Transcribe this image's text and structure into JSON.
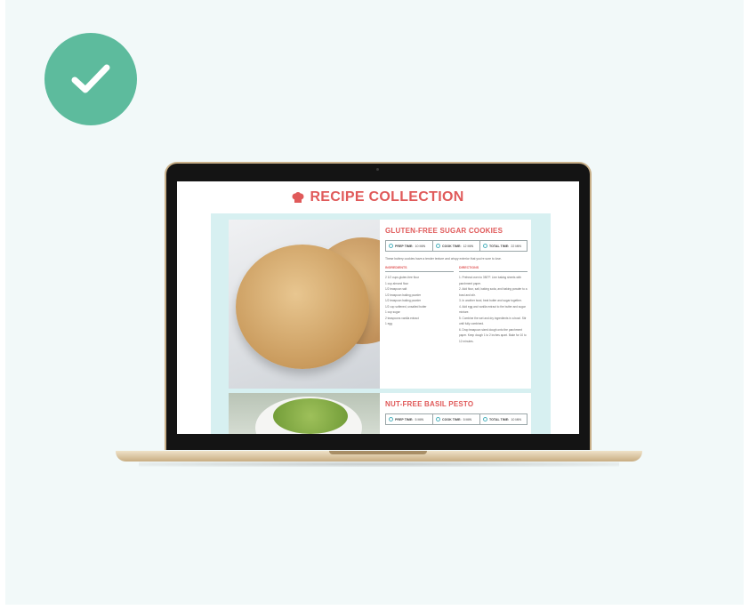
{
  "badge": {
    "icon": "checkmark-icon",
    "color": "#5dbb9d"
  },
  "page": {
    "title": "RECIPE COLLECTION",
    "icon": "chef-hat-icon",
    "accent": "#e05a5a",
    "collection_bg": "#d7f0f1"
  },
  "recipes": [
    {
      "title": "GLUTEN-FREE SUGAR COOKIES",
      "times": [
        {
          "label": "PREP TIME:",
          "value": "10 MIN"
        },
        {
          "label": "COOK TIME:",
          "value": "12 MIN"
        },
        {
          "label": "TOTAL TIME:",
          "value": "22 MIN"
        }
      ],
      "description": "These buttery cookies have a tender texture and crispy exterior that you're sure to love.",
      "ingredients_heading": "INGREDIENTS",
      "directions_heading": "DIRECTIONS",
      "ingredients": [
        "2 1/2 cups gluten-free flour",
        "1 cup almond flour",
        "1/2 teaspoon salt",
        "1/2 teaspoon baking powder",
        "1/2 teaspoon baking powder",
        "1/2 cup softened, unsalted butter",
        "1 cup sugar",
        "2 teaspoons vanilla extract",
        "1 egg"
      ],
      "directions": [
        "1. Preheat oven to 350°F. Line baking sheets with parchment paper.",
        "2. Add flour, salt, baking soda, and baking powder to a bowl and stir.",
        "3. In another bowl, beat butter and sugar together.",
        "4. Add egg and vanilla extract to the butter and sugar mixture.",
        "5. Combine the wet and dry ingredients in a bowl. Stir until fully combined.",
        "6. Drop teaspoon sized dough onto the parchment paper. Keep dough 1 to 2 inches apart. Bake for 10 to 12 minutes."
      ]
    },
    {
      "title": "NUT-FREE BASIL PESTO",
      "times": [
        {
          "label": "PREP TIME:",
          "value": "5 MIN"
        },
        {
          "label": "COOK TIME:",
          "value": "5 MIN"
        },
        {
          "label": "TOTAL TIME:",
          "value": "10 MIN"
        }
      ]
    }
  ]
}
